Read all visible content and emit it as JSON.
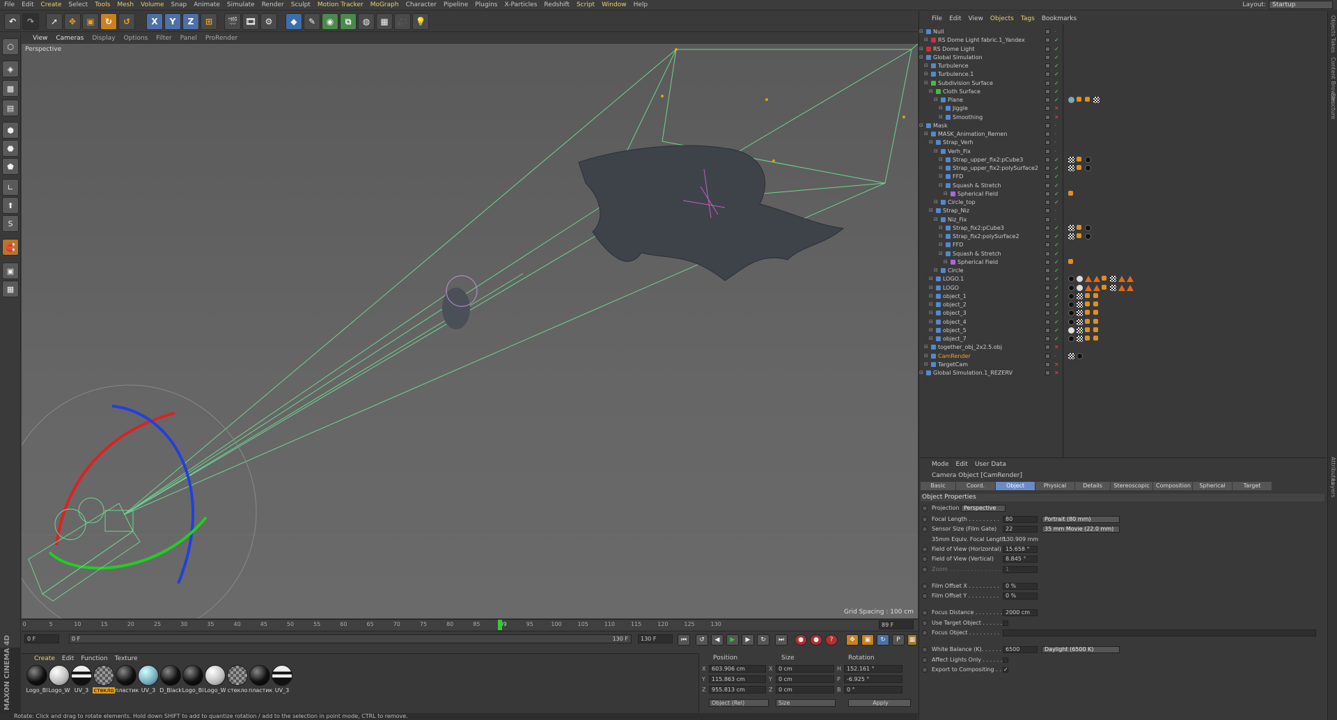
{
  "menu": [
    "File",
    "Edit",
    "Create",
    "Select",
    "Tools",
    "Mesh",
    "Volume",
    "Snap",
    "Animate",
    "Simulate",
    "Render",
    "Sculpt",
    "Motion Tracker",
    "MoGraph",
    "Character",
    "Pipeline",
    "Plugins",
    "X-Particles",
    "Redshift",
    "Script",
    "Window",
    "Help"
  ],
  "layout": {
    "label": "Layout:",
    "value": "Startup"
  },
  "toolbar": {
    "x": "X",
    "y": "Y",
    "z": "Z"
  },
  "viewport_menu": [
    "View",
    "Cameras",
    "Display",
    "Options",
    "Filter",
    "Panel",
    "ProRender"
  ],
  "viewport": {
    "label": "Perspective",
    "grid_spacing": "Grid Spacing : 100 cm"
  },
  "timeline": {
    "ticks": [
      "0",
      "5",
      "10",
      "15",
      "20",
      "25",
      "30",
      "35",
      "40",
      "45",
      "50",
      "55",
      "60",
      "65",
      "70",
      "75",
      "80",
      "85",
      "89",
      "95",
      "100",
      "105",
      "110",
      "115",
      "120",
      "125",
      "130"
    ],
    "current": "89 F"
  },
  "frames": {
    "start": "0 F",
    "start2": "0 F",
    "end": "130 F",
    "end2": "130 F"
  },
  "materials": {
    "menu": [
      "Create",
      "Edit",
      "Function",
      "Texture"
    ],
    "items": [
      {
        "name": "Logo_Bl",
        "style": "black"
      },
      {
        "name": "Logo_W",
        "style": "white"
      },
      {
        "name": "UV_3",
        "style": "stripe"
      },
      {
        "name": "стекло",
        "style": "check"
      },
      {
        "name": "пластик",
        "style": "black"
      },
      {
        "name": "UV_3",
        "style": "blue"
      },
      {
        "name": "D_Black",
        "style": "black"
      },
      {
        "name": "Logo_Bl",
        "style": "black"
      },
      {
        "name": "Logo_W",
        "style": "white"
      },
      {
        "name": "стекло",
        "style": "check"
      },
      {
        "name": "пластик",
        "style": "black"
      },
      {
        "name": "UV_3",
        "style": "stripe"
      }
    ]
  },
  "brand": "MAXON CINEMA 4D",
  "coords": {
    "headers": [
      "Position",
      "Size",
      "Rotation"
    ],
    "x": {
      "pos": "603.906 cm",
      "size": "0 cm",
      "rot": "152.161 °"
    },
    "y": {
      "pos": "115.863 cm",
      "size": "0 cm",
      "rot": "-6.925 °"
    },
    "z": {
      "pos": "955.813 cm",
      "size": "0 cm",
      "rot": "0 °"
    },
    "labels": {
      "x": "X",
      "y": "Y",
      "z": "Z",
      "h": "H",
      "p": "P",
      "b": "B"
    },
    "mode": "Object (Rel)",
    "size_mode": "Size",
    "apply": "Apply"
  },
  "status": "Rotate: Click and drag to rotate elements. Hold down SHIFT to add to quantize rotation / add to the selection in point mode, CTRL to remove.",
  "objects": {
    "menu": [
      "File",
      "Edit",
      "View",
      "Objects",
      "Tags",
      "Bookmarks"
    ],
    "rows": [
      {
        "name": "Null",
        "indent": 0,
        "icon": "blu",
        "chk": "g"
      },
      {
        "name": "RS Dome Light fabric.1_Yandex",
        "indent": 1,
        "icon": "red",
        "chk": "ok"
      },
      {
        "name": "RS Dome Light",
        "indent": 0,
        "icon": "red",
        "chk": "ok"
      },
      {
        "name": "Global Simulation",
        "indent": 0,
        "icon": "blu",
        "chk": "ok"
      },
      {
        "name": "Turbulence",
        "indent": 1,
        "icon": "blu",
        "chk": "ok"
      },
      {
        "name": "Turbulence.1",
        "indent": 1,
        "icon": "blu",
        "chk": "ok"
      },
      {
        "name": "Subdivision Surface",
        "indent": 1,
        "icon": "grn",
        "chk": "ok"
      },
      {
        "name": "Cloth Surface",
        "indent": 2,
        "icon": "grn",
        "chk": "ok"
      },
      {
        "name": "Plane",
        "indent": 3,
        "icon": "blu",
        "chk": "ok"
      },
      {
        "name": "Jiggle",
        "indent": 4,
        "icon": "blu",
        "chk": "x"
      },
      {
        "name": "Smoothing",
        "indent": 4,
        "icon": "blu",
        "chk": "x"
      },
      {
        "name": "Mask",
        "indent": 0,
        "icon": "blu",
        "chk": "g"
      },
      {
        "name": "MASK_Animation_Remen",
        "indent": 1,
        "icon": "blu",
        "chk": "g"
      },
      {
        "name": "Strap_Verh",
        "indent": 2,
        "icon": "blu",
        "chk": "g"
      },
      {
        "name": "Verh_Fix",
        "indent": 3,
        "icon": "blu",
        "chk": "g"
      },
      {
        "name": "Strap_upper_fix2:pCube3",
        "indent": 4,
        "icon": "blu",
        "chk": "ok"
      },
      {
        "name": "Strap_upper_fix2:polySurface2",
        "indent": 4,
        "icon": "blu",
        "chk": "ok"
      },
      {
        "name": "FFD",
        "indent": 4,
        "icon": "blu",
        "chk": "ok"
      },
      {
        "name": "Squash & Stretch",
        "indent": 4,
        "icon": "blu",
        "chk": "ok"
      },
      {
        "name": "Spherical Field",
        "indent": 5,
        "icon": "pur",
        "chk": "ok"
      },
      {
        "name": "Circle_top",
        "indent": 3,
        "icon": "blu",
        "chk": "ok"
      },
      {
        "name": "Strap_Niz",
        "indent": 2,
        "icon": "blu",
        "chk": "g"
      },
      {
        "name": "Niz_Fix",
        "indent": 3,
        "icon": "blu",
        "chk": "g"
      },
      {
        "name": "Strap_fix2:pCube3",
        "indent": 4,
        "icon": "blu",
        "chk": "ok"
      },
      {
        "name": "Strap_fix2:polySurface2",
        "indent": 4,
        "icon": "blu",
        "chk": "ok"
      },
      {
        "name": "FFD",
        "indent": 4,
        "icon": "blu",
        "chk": "ok"
      },
      {
        "name": "Squash & Stretch",
        "indent": 4,
        "icon": "blu",
        "chk": "ok"
      },
      {
        "name": "Spherical Field",
        "indent": 5,
        "icon": "pur",
        "chk": "ok"
      },
      {
        "name": "Circle",
        "indent": 3,
        "icon": "blu",
        "chk": "ok"
      },
      {
        "name": "LOGO.1",
        "indent": 2,
        "icon": "blu",
        "chk": "ok"
      },
      {
        "name": "LOGO",
        "indent": 2,
        "icon": "blu",
        "chk": "ok"
      },
      {
        "name": "object_1",
        "indent": 2,
        "icon": "blu",
        "chk": "ok"
      },
      {
        "name": "object_2",
        "indent": 2,
        "icon": "blu",
        "chk": "ok"
      },
      {
        "name": "object_3",
        "indent": 2,
        "icon": "blu",
        "chk": "ok"
      },
      {
        "name": "object_4",
        "indent": 2,
        "icon": "blu",
        "chk": "ok"
      },
      {
        "name": "object_5",
        "indent": 2,
        "icon": "blu",
        "chk": "ok"
      },
      {
        "name": "object_7",
        "indent": 2,
        "icon": "blu",
        "chk": "ok"
      },
      {
        "name": "together_obj_2x2.5.obj",
        "indent": 1,
        "icon": "blu",
        "chk": "x"
      },
      {
        "name": "CamRender",
        "indent": 1,
        "icon": "blu",
        "chk": "g",
        "style": "or"
      },
      {
        "name": "TargetCam",
        "indent": 1,
        "icon": "blu",
        "chk": "x"
      },
      {
        "name": "Global Simulation.1_REZERV",
        "indent": 0,
        "icon": "blu",
        "chk": "x"
      }
    ]
  },
  "attributes": {
    "menu": [
      "Mode",
      "Edit",
      "User Data"
    ],
    "title": "Camera Object [CamRender]",
    "tabs": [
      "Basic",
      "Coord.",
      "Object",
      "Physical",
      "Details",
      "Stereoscopic",
      "Composition",
      "Spherical",
      "Target"
    ],
    "active_tab": "Object",
    "section": "Object Properties",
    "projection": {
      "label": "Projection",
      "value": "Perspective"
    },
    "rows": [
      {
        "label": "Focal Length . . . . . . . . .",
        "value": "80",
        "dropdown": "Portrait (80 mm)"
      },
      {
        "label": "Sensor Size (Film Gate)",
        "value": "22",
        "dropdown": "35 mm Movie (22.0 mm)"
      },
      {
        "label": "35mm Equiv. Focal Length:",
        "value": "130.909 mm",
        "plain": true
      },
      {
        "label": "Field of View (Horizontal)",
        "value": "15.658 °"
      },
      {
        "label": "Field of View (Vertical)",
        "value": "8.845 °"
      },
      {
        "label": "Zoom . . . . . . . . . . . . . . . .",
        "value": "1",
        "dim": true
      },
      {
        "label": "Film Offset X . . . . . . . . .",
        "value": "0 %"
      },
      {
        "label": "Film Offset Y . . . . . . . . .",
        "value": "0 %"
      },
      {
        "label": "Focus Distance . . . . . . . .",
        "value": "2000 cm"
      },
      {
        "label": "Use Target Object . . . . . .",
        "check": " "
      },
      {
        "label": "Focus Object . . . . . . . . .",
        "wide": true
      },
      {
        "label": "White Balance (K). . . . . .",
        "value": "6500",
        "dropdown": "Daylight (6500 K)"
      },
      {
        "label": "Affect Lights Only . . . . . .",
        "check": " "
      },
      {
        "label": "Export to Compositing . . . .",
        "check": "✓"
      }
    ]
  },
  "right_tabs": [
    "Objects",
    "Takes",
    "Content Browser",
    "Structure",
    "Attributes",
    "Layers"
  ]
}
